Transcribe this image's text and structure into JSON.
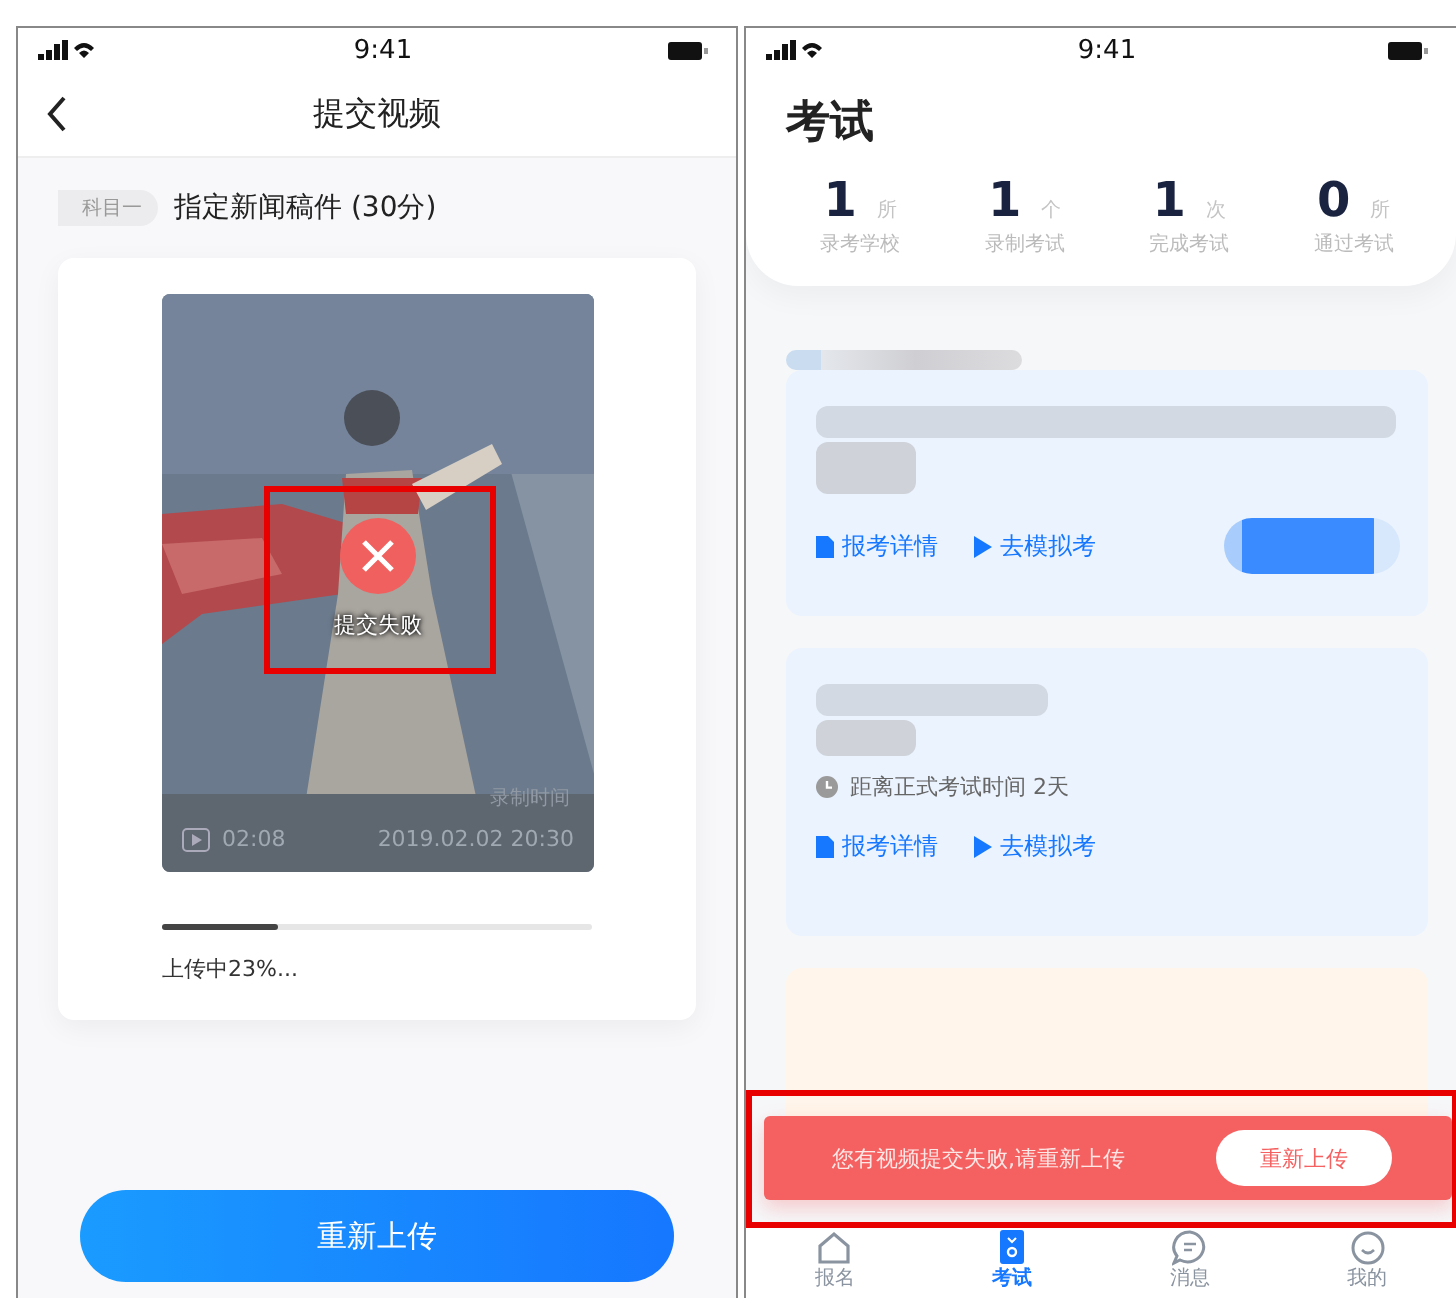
{
  "left_screen": {
    "status_bar": {
      "time": "9:41"
    },
    "nav": {
      "title": "提交视频"
    },
    "subject": {
      "tag": "科目一",
      "title": "指定新闻稿件 (30分)"
    },
    "video": {
      "kind": "picture",
      "failed": true,
      "status": "提交失败",
      "recorded_label": "录制时间",
      "duration": "02:08",
      "recorded_time": "2019.02.02 20:30"
    },
    "upload": {
      "level": 0.27,
      "text": "上传中23%..."
    },
    "button": "重新上传"
  },
  "right_screen": {
    "status_bar": {
      "time": "9:41"
    },
    "title": "考试",
    "stats": [
      {
        "value": "1",
        "unit": "所",
        "label": "录考学校"
      },
      {
        "value": "1",
        "unit": "个",
        "label": "录制考试"
      },
      {
        "value": "1",
        "unit": "次",
        "label": "完成考试"
      },
      {
        "value": "0",
        "unit": "所",
        "label": "通过考试"
      }
    ],
    "cards": [
      {
        "kind": "action",
        "links": [
          "报考详情",
          "去模拟考"
        ]
      },
      {
        "kind": "countdown",
        "countdown": "距离正式考试时间 2天",
        "links": [
          "报考详情",
          "去模拟考"
        ]
      },
      {
        "kind": "covered"
      }
    ],
    "toast": {
      "message": "您有视频提交失败,请重新上传",
      "button": "重新上传"
    },
    "tabs": [
      {
        "kind": "home",
        "label": "报名",
        "selected": false
      },
      {
        "kind": "exam",
        "label": "考试",
        "selected": true
      },
      {
        "kind": "message",
        "label": "消息",
        "selected": false
      },
      {
        "kind": "profile",
        "label": "我的",
        "selected": false
      }
    ]
  }
}
